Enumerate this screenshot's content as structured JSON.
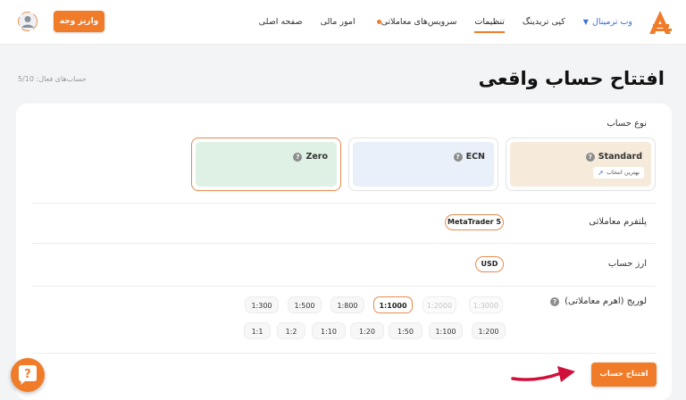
{
  "nav": {
    "items": [
      {
        "label": "صفحه اصلی"
      },
      {
        "label": "امور مالی"
      },
      {
        "label": "سرویس‌های معاملاتی"
      },
      {
        "label": "تنظیمات"
      },
      {
        "label": "کپی تریدینگ"
      },
      {
        "label": "وب ترمینال"
      }
    ],
    "deposit_label": "واریز وجه"
  },
  "page": {
    "title": "افتتاح حساب واقعی",
    "active_accounts": "حساب‌های فعال: 5/10"
  },
  "form": {
    "account_type_label": "نوع حساب",
    "account_types": [
      {
        "name": "Standard",
        "badge": "بهترین انتخاب"
      },
      {
        "name": "ECN"
      },
      {
        "name": "Zero"
      }
    ],
    "platform_label": "پلتفرم معاملاتی",
    "platform_value": "MetaTrader 5",
    "currency_label": "ارز حساب",
    "currency_value": "USD",
    "leverage_label": "لوریج (اهرم معاملاتی)",
    "leverage_row1": [
      "1:3000",
      "1:2000",
      "1:1000",
      "1:800",
      "1:500",
      "1:300"
    ],
    "leverage_row2": [
      "1:200",
      "1:100",
      "1:50",
      "1:20",
      "1:10",
      "1:2",
      "1:1"
    ],
    "submit_label": "افتتاح حساب"
  },
  "colors": {
    "accent": "#f07c2a",
    "link": "#3b6fd4"
  }
}
